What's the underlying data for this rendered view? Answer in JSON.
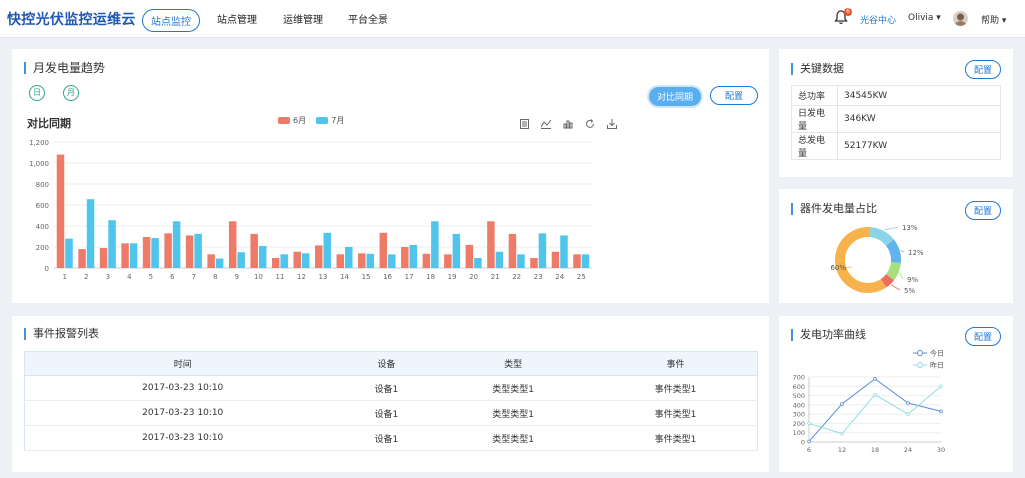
{
  "header": {
    "brand": "快控光伏监控运维云",
    "nav": [
      "站点监控",
      "站点管理",
      "运维管理",
      "平台全景"
    ],
    "badge_count": "6",
    "message_center": "光谷中心",
    "user": "Olivia ▾",
    "help": "帮助 ▾"
  },
  "monthly": {
    "title": "月发电量趋势",
    "tab_day": "日",
    "tab_month": "月",
    "compare_btn": "对比同期",
    "config_btn": "配置",
    "chart_title": "对比同期"
  },
  "keydata": {
    "title": "关键数据",
    "config_btn": "配置",
    "rows": [
      {
        "k": "总功率",
        "v": "34545KW"
      },
      {
        "k": "日发电量",
        "v": "346KW"
      },
      {
        "k": "总发电量",
        "v": "52177KW"
      }
    ]
  },
  "ratio": {
    "title": "器件发电量占比",
    "config_btn": "配置"
  },
  "events": {
    "title": "事件报警列表",
    "headers": [
      "时间",
      "设备",
      "类型",
      "事件"
    ],
    "rows": [
      [
        "2017-03-23 10:10",
        "设备1",
        "类型类型1",
        "事件类型1"
      ],
      [
        "2017-03-23 10:10",
        "设备1",
        "类型类型1",
        "事件类型1"
      ],
      [
        "2017-03-23 10:10",
        "设备1",
        "类型类型1",
        "事件类型1"
      ]
    ]
  },
  "power": {
    "title": "发电功率曲线",
    "config_btn": "配置"
  },
  "colors": {
    "red": "#ee7b67",
    "blue": "#4fc4ec",
    "accent": "#1f78d1"
  },
  "chart_data": [
    {
      "type": "bar",
      "title": "对比同期",
      "categories": [
        "1",
        "2",
        "3",
        "4",
        "5",
        "6",
        "7",
        "8",
        "9",
        "10",
        "11",
        "12",
        "13",
        "14",
        "15",
        "16",
        "17",
        "18",
        "19",
        "20",
        "21",
        "22",
        "23",
        "24",
        "25"
      ],
      "series": [
        {
          "name": "6月",
          "color": "#ee7b67",
          "values": [
            1080,
            180,
            190,
            235,
            295,
            330,
            310,
            130,
            445,
            325,
            95,
            155,
            215,
            130,
            140,
            335,
            200,
            135,
            130,
            220,
            445,
            325,
            95,
            155,
            130
          ]
        },
        {
          "name": "7月",
          "color": "#4fc4ec",
          "values": [
            280,
            655,
            455,
            235,
            285,
            445,
            325,
            90,
            150,
            210,
            130,
            140,
            335,
            200,
            135,
            130,
            220,
            445,
            325,
            95,
            155,
            130,
            330,
            310,
            130
          ]
        }
      ],
      "ylim": [
        0,
        1200
      ],
      "yticks": [
        0,
        200,
        400,
        600,
        800,
        "1,000",
        "1,200"
      ],
      "legend": "top-center",
      "grid": true
    },
    {
      "type": "pie",
      "labels": [
        "60%",
        "13%",
        "12%",
        "9%",
        "5%"
      ],
      "values": [
        60,
        13,
        12,
        9,
        5
      ],
      "colors": [
        "#f7b24b",
        "#8ad4e8",
        "#5fb4f0",
        "#a6e07a",
        "#ee6d5e"
      ]
    },
    {
      "type": "line",
      "x": [
        6,
        12,
        18,
        24,
        30
      ],
      "series": [
        {
          "name": "今日",
          "color": "#5b8fd6",
          "values": [
            5,
            410,
            680,
            420,
            330
          ]
        },
        {
          "name": "昨日",
          "color": "#8fdde0",
          "values": [
            200,
            90,
            510,
            300,
            600
          ]
        }
      ],
      "ylim": [
        0,
        700
      ],
      "yticks": [
        0,
        100,
        200,
        300,
        400,
        500,
        600,
        700
      ],
      "legend": "top-right",
      "grid": true
    }
  ]
}
